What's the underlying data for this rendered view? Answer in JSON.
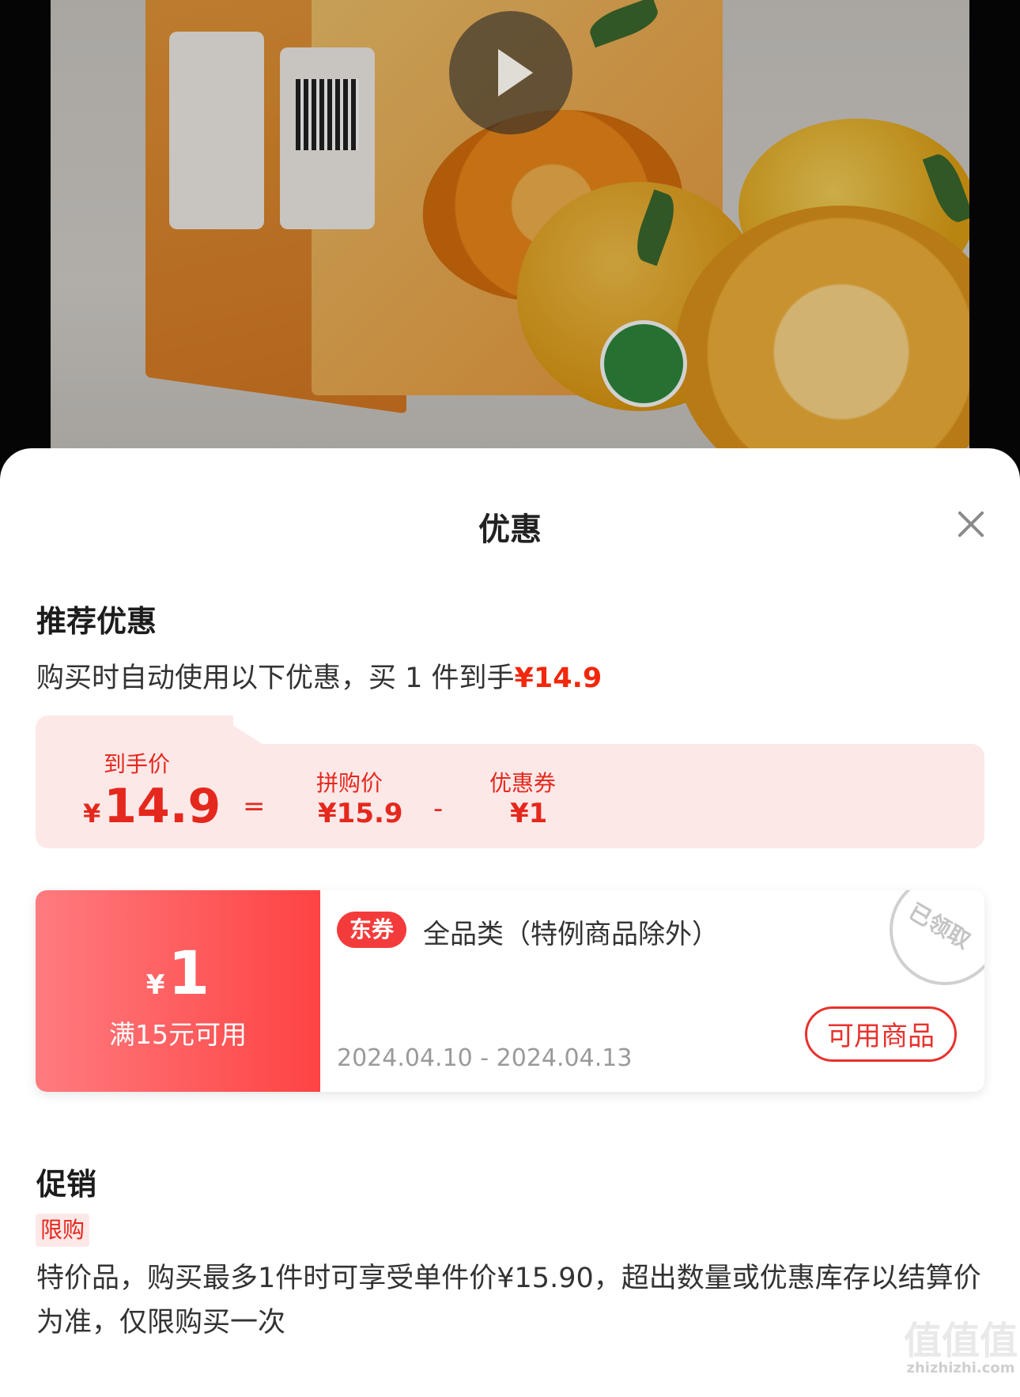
{
  "media": {
    "image_alt": "product-photo-orange-gift-box",
    "play_icon": "play-icon"
  },
  "sheet": {
    "title": "优惠",
    "close_icon": "close-icon"
  },
  "recommended": {
    "heading": "推荐优惠",
    "subtitle_prefix": "购买时自动使用以下优惠，买 1 件到手",
    "subtitle_price": "¥14.9",
    "calc": {
      "final_label": "到手价",
      "final_currency": "¥",
      "final_value": "14.9",
      "equals": "=",
      "group_label": "拼购价",
      "group_value": "¥15.9",
      "minus": "-",
      "coupon_label": "优惠券",
      "coupon_value": "¥1"
    }
  },
  "coupon": {
    "currency": "¥",
    "amount": "1",
    "condition": "满15元可用",
    "tag": "东券",
    "description": "全品类（特例商品除外）",
    "date_range": "2024.04.10 - 2024.04.13",
    "button": "可用商品",
    "stamp": "已领取"
  },
  "promotion": {
    "heading": "促销",
    "tag": "限购",
    "text": "特价品，购买最多1件时可享受单件价¥15.90，超出数量或优惠库存以结算价为准，仅限购买一次"
  },
  "watermark": {
    "text": "值值值",
    "url": "zhizhizhi.com"
  },
  "colors": {
    "accent_red": "#f2270c",
    "coupon_gradient_start": "#ff7b7f",
    "coupon_gradient_end": "#fe4343",
    "calc_background": "#fde8e8"
  }
}
